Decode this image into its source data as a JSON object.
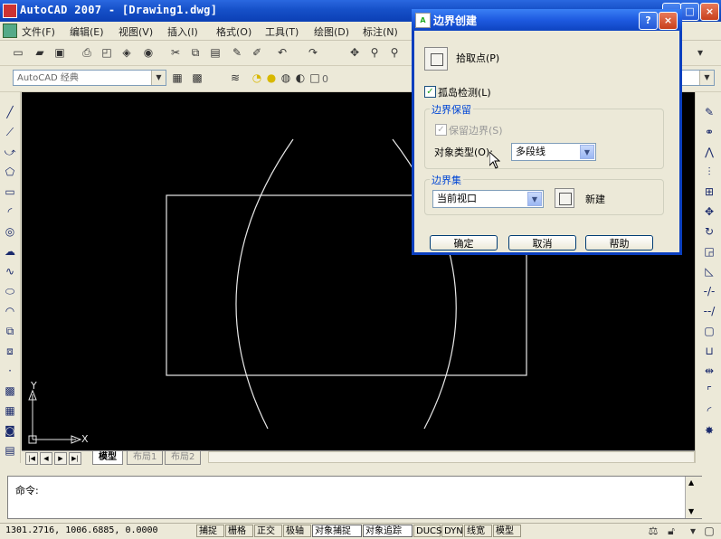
{
  "window": {
    "title": "AutoCAD 2007 - [Drawing1.dwg]",
    "min": "_",
    "max": "□",
    "close": "×"
  },
  "menu": [
    "文件(F)",
    "编辑(E)",
    "视图(V)",
    "插入(I)",
    "格式(O)",
    "工具(T)",
    "绘图(D)",
    "标注(N)"
  ],
  "toolbar": {
    "workspace": "AutoCAD 经典",
    "layer_value": "0"
  },
  "dialog": {
    "title": "边界创建",
    "help_btn": "?",
    "close_btn": "×",
    "pick_points": "拾取点(P)",
    "island_detection": "孤岛检测(L)",
    "retention_group": "边界保留",
    "retain_boundaries": "保留边界(S)",
    "object_type_label": "对象类型(O):",
    "object_type_value": "多段线",
    "boundary_set_group": "边界集",
    "boundary_set_value": "当前视口",
    "new_label": "新建",
    "ok": "确定",
    "cancel": "取消",
    "help": "帮助"
  },
  "tabs": {
    "model": "模型",
    "layout1": "布局1",
    "layout2": "布局2"
  },
  "ucs": {
    "x": "X",
    "y": "Y"
  },
  "command": {
    "prompt": "命令:"
  },
  "status": {
    "coords": "1301.2716, 1006.6885, 0.0000",
    "buttons": [
      "捕捉",
      "栅格",
      "正交",
      "极轴",
      "对象捕捉",
      "对象追踪",
      "DUCS",
      "DYN",
      "线宽",
      "模型"
    ]
  },
  "icons": {
    "accent": "#0A3FBF",
    "check_color": "#21a121"
  }
}
